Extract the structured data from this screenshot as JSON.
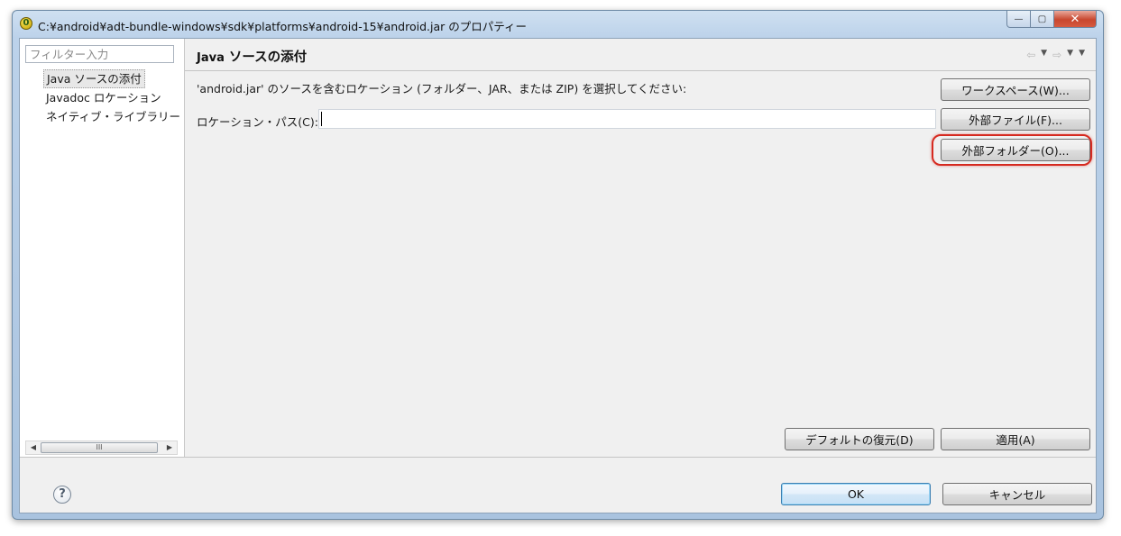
{
  "window": {
    "title": "C:¥android¥adt-bundle-windows¥sdk¥platforms¥android-15¥android.jar のプロパティー",
    "app_icon_glyph": "0",
    "minimize_glyph": "—",
    "maximize_glyph": "▢",
    "close_glyph": "✕"
  },
  "left": {
    "filter_placeholder": "フィルター入力",
    "tree": [
      {
        "label": "Java ソースの添付",
        "selected": true
      },
      {
        "label": "Javadoc ロケーション",
        "selected": false
      },
      {
        "label": "ネイティブ・ライブラリー",
        "selected": false
      }
    ],
    "scroll_left": "◀",
    "scroll_right": "▶",
    "scroll_grip": "III"
  },
  "page": {
    "title_java": "Java",
    "title_rest": " ソースの添付",
    "nav_back": "⇦",
    "nav_forward": "⇨",
    "nav_dropdown": "▼",
    "description": "'android.jar' のソースを含むロケーション (フォルダー、JAR、または ZIP) を選択してください:",
    "location_label": "ロケーション・パス(C):",
    "location_value": "",
    "buttons": {
      "workspace": "ワークスペース(W)...",
      "external_file": "外部ファイル(F)...",
      "external_folder": "外部フォルダー(O)...",
      "restore_defaults": "デフォルトの復元(D)",
      "apply": "適用(A)"
    }
  },
  "footer": {
    "help_glyph": "?",
    "ok": "OK",
    "cancel": "キャンセル"
  },
  "colors": {
    "highlight": "#d62a20",
    "default_button_border": "#3c7fb1"
  }
}
